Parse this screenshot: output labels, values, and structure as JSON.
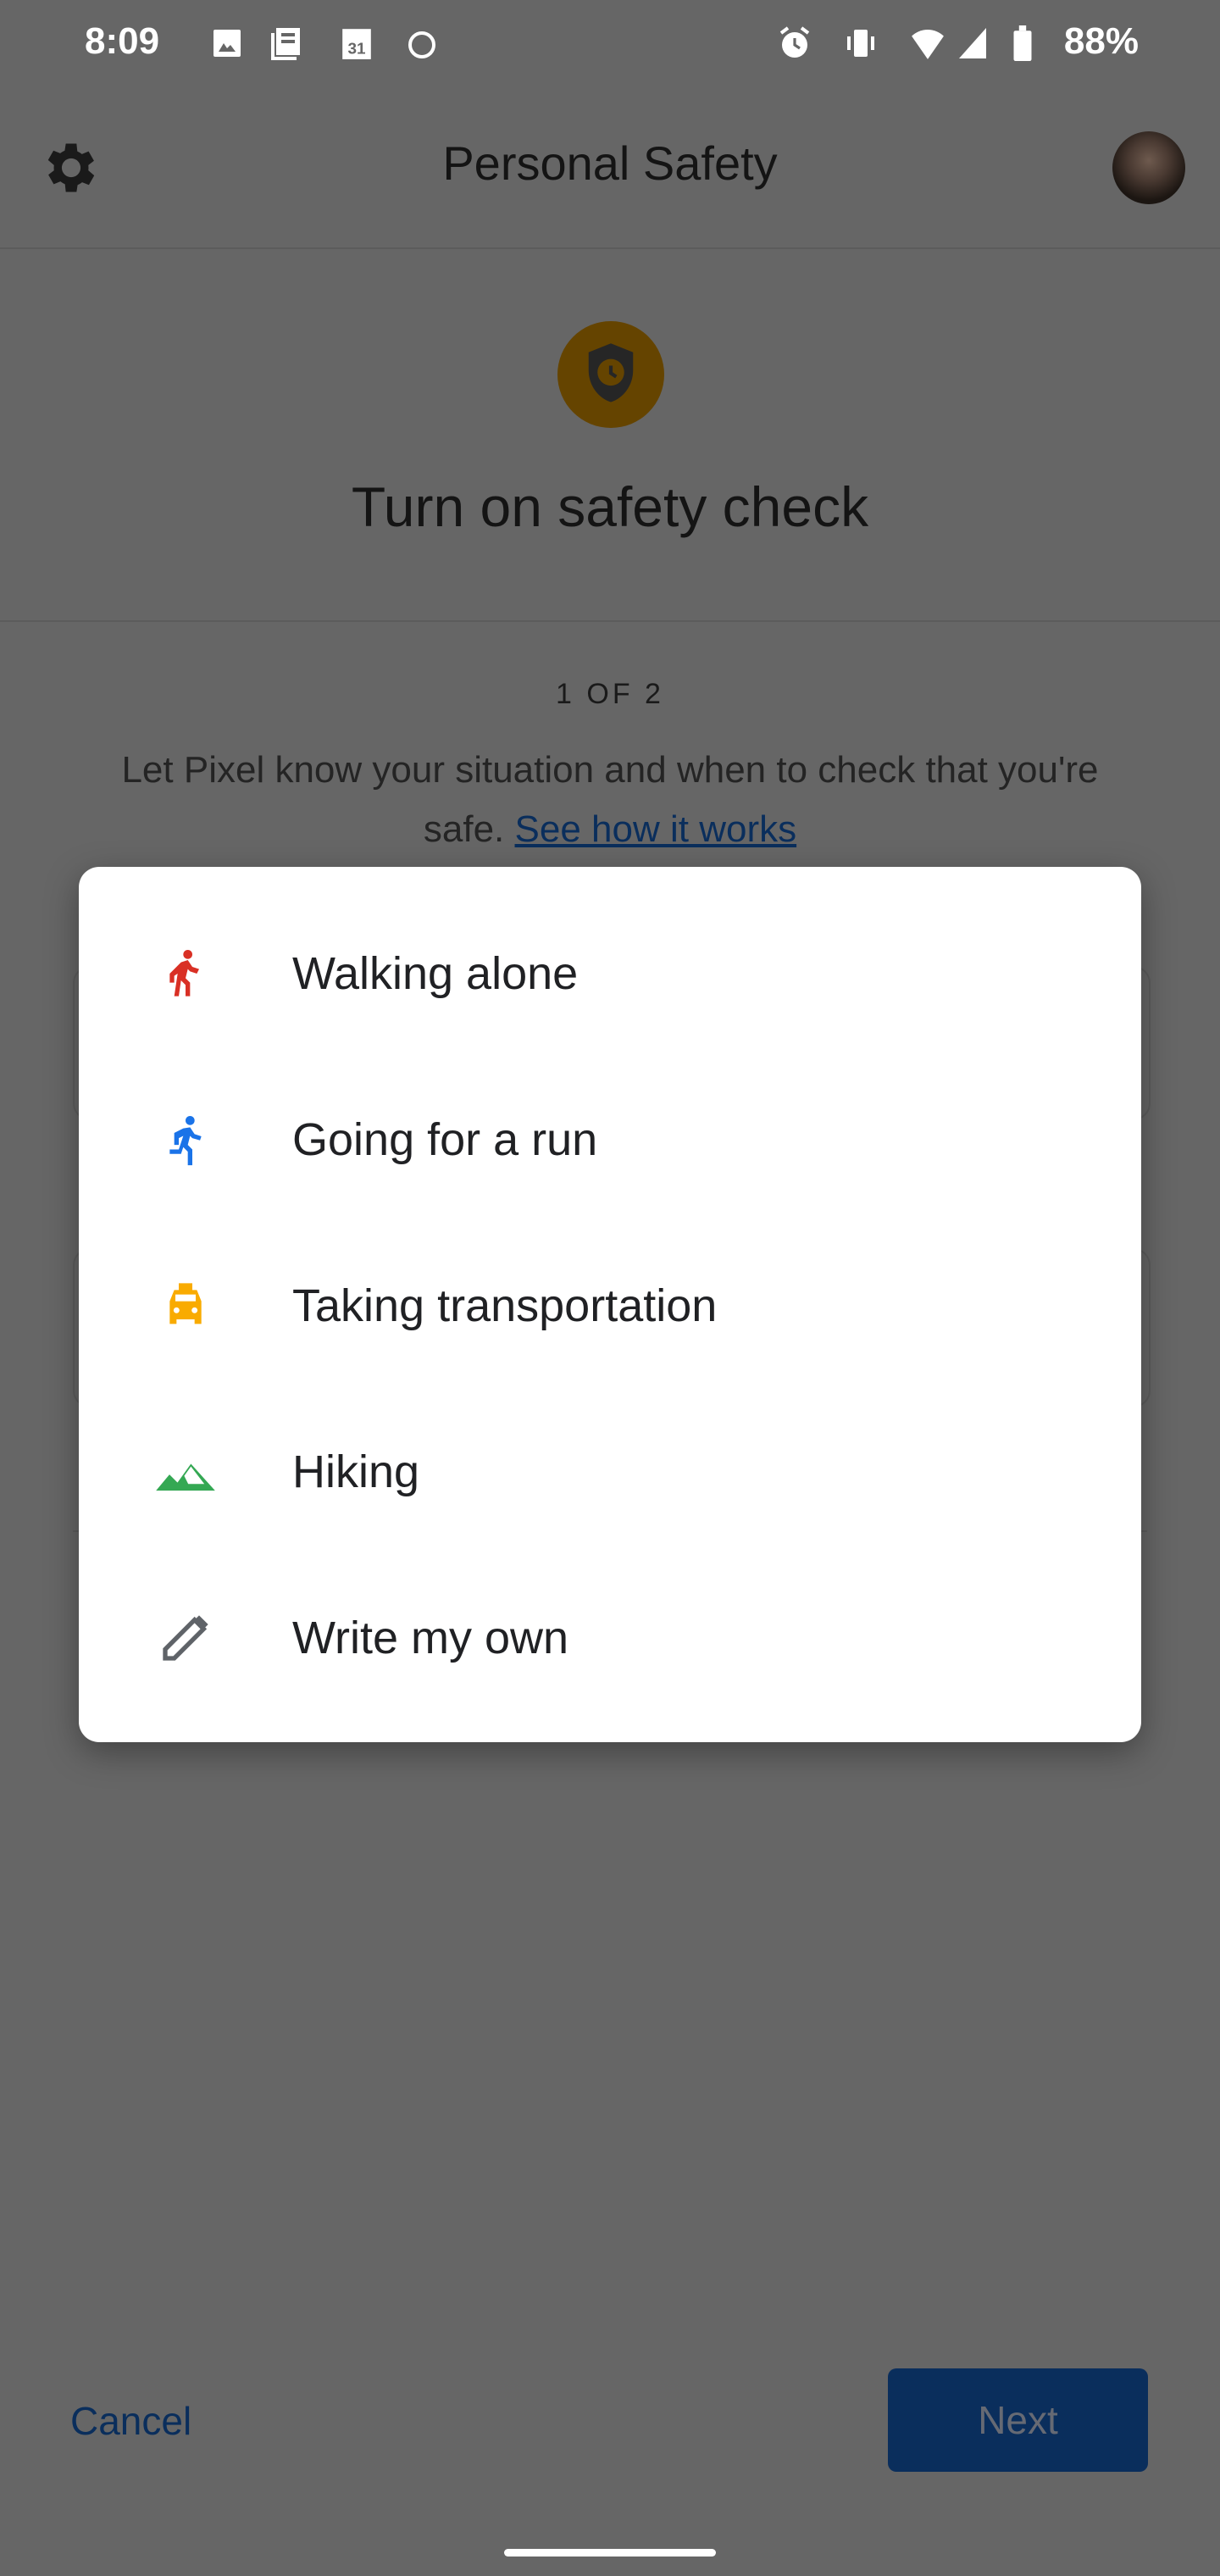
{
  "status_bar": {
    "time": "8:09",
    "battery": "88%",
    "icons_left": [
      "image-icon",
      "news-icon",
      "calendar-icon",
      "alarm-icon"
    ],
    "icons_right": [
      "alarm-icon",
      "vibrate-icon",
      "wifi-icon",
      "signal-icon",
      "battery-icon"
    ],
    "calendar_day": "31"
  },
  "app_bar": {
    "title": "Personal Safety",
    "settings_icon": "gear-icon",
    "avatar": "avatar"
  },
  "page": {
    "heading": "Turn on safety check",
    "step": "1 OF 2",
    "description": "Let Pixel know your situation and when to check that you're safe.",
    "link": "See how it works",
    "accent": "#f9ab00"
  },
  "footer": {
    "cancel": "Cancel",
    "next": "Next",
    "primary_color": "#1a73e8"
  },
  "dialog": {
    "items": [
      {
        "label": "Walking alone",
        "icon": "walk-icon",
        "color": "#d93025"
      },
      {
        "label": "Going for a run",
        "icon": "run-icon",
        "color": "#1a73e8"
      },
      {
        "label": "Taking transportation",
        "icon": "taxi-icon",
        "color": "#f9ab00"
      },
      {
        "label": "Hiking",
        "icon": "mountain-icon",
        "color": "#34a853"
      },
      {
        "label": "Write my own",
        "icon": "pencil-icon",
        "color": "#5f6368"
      }
    ]
  }
}
